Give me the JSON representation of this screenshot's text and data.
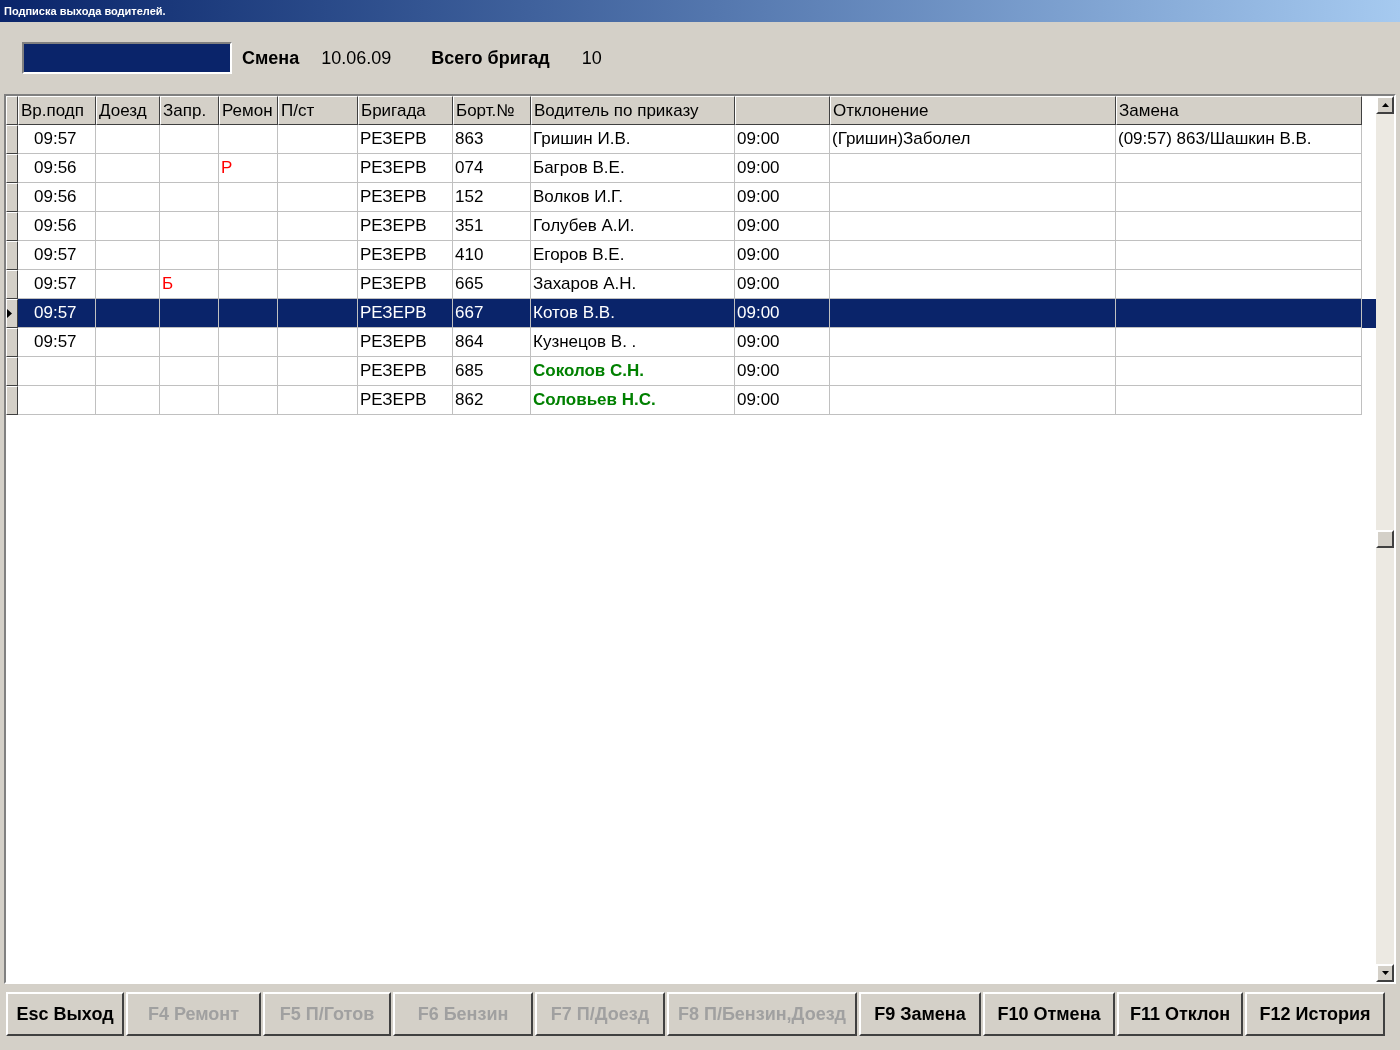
{
  "window": {
    "title": "Подписка выхода водителей."
  },
  "header": {
    "shift_label": "Смена",
    "shift_value": "10.06.09",
    "total_label": "Всего бригад",
    "total_value": "10"
  },
  "table": {
    "columns": [
      {
        "label": "Вр.подп"
      },
      {
        "label": "Доезд"
      },
      {
        "label": "Запр."
      },
      {
        "label": "Ремон"
      },
      {
        "label": "П/ст"
      },
      {
        "label": "Бригада"
      },
      {
        "label": "Борт.№"
      },
      {
        "label": "Водитель по приказу"
      },
      {},
      {
        "label": "Отклонение"
      },
      {
        "label": "Замена"
      }
    ],
    "rows": [
      {
        "selected": false,
        "driver_highlighted": false,
        "cells": [
          "09:57",
          "",
          "",
          "",
          "",
          "РЕЗЕРВ",
          "863",
          "Гришин И.В.",
          "09:00",
          "(Гришин)Заболел",
          "(09:57) 863/Шашкин В.В."
        ]
      },
      {
        "selected": false,
        "driver_highlighted": false,
        "cells": [
          "09:56",
          "",
          "",
          "Р",
          "",
          "РЕЗЕРВ",
          "074",
          "Багров В.Е.",
          "09:00",
          "",
          ""
        ]
      },
      {
        "selected": false,
        "driver_highlighted": false,
        "cells": [
          "09:56",
          "",
          "",
          "",
          "",
          "РЕЗЕРВ",
          "152",
          "Волков И.Г.",
          "09:00",
          "",
          ""
        ]
      },
      {
        "selected": false,
        "driver_highlighted": false,
        "cells": [
          "09:56",
          "",
          "",
          "",
          "",
          "РЕЗЕРВ",
          "351",
          "Голубев А.И.",
          "09:00",
          "",
          ""
        ]
      },
      {
        "selected": false,
        "driver_highlighted": false,
        "cells": [
          "09:57",
          "",
          "",
          "",
          "",
          "РЕЗЕРВ",
          "410",
          "Егоров В.Е.",
          "09:00",
          "",
          ""
        ]
      },
      {
        "selected": false,
        "driver_highlighted": false,
        "cells": [
          "09:57",
          "",
          "Б",
          "",
          "",
          "РЕЗЕРВ",
          "665",
          "Захаров А.Н.",
          "09:00",
          "",
          ""
        ]
      },
      {
        "selected": true,
        "driver_highlighted": false,
        "cells": [
          "09:57",
          "",
          "",
          "",
          "",
          "РЕЗЕРВ",
          "667",
          "Котов В.В.",
          "09:00",
          "",
          ""
        ]
      },
      {
        "selected": false,
        "driver_highlighted": false,
        "cells": [
          "09:57",
          "",
          "",
          "",
          "",
          "РЕЗЕРВ",
          "864",
          "Кузнецов В. .",
          "09:00",
          "",
          ""
        ]
      },
      {
        "selected": false,
        "driver_highlighted": true,
        "cells": [
          "",
          "",
          "",
          "",
          "",
          "РЕЗЕРВ",
          "685",
          "Соколов С.Н.",
          "09:00",
          "",
          ""
        ]
      },
      {
        "selected": false,
        "driver_highlighted": true,
        "cells": [
          "",
          "",
          "",
          "",
          "",
          "РЕЗЕРВ",
          "862",
          "Соловьев Н.С.",
          "09:00",
          "",
          ""
        ]
      }
    ]
  },
  "buttons": [
    {
      "label": "Esc Выход",
      "disabled": false
    },
    {
      "label": "F4 Ремонт",
      "disabled": true
    },
    {
      "label": "F5 П/Готов",
      "disabled": true
    },
    {
      "label": "F6 Бензин",
      "disabled": true
    },
    {
      "label": "F7 П/Доезд",
      "disabled": true
    },
    {
      "label": "F8 П/Бензин,Доезд",
      "disabled": true
    },
    {
      "label": "F9 Замена",
      "disabled": false
    },
    {
      "label": "F10 Отмена",
      "disabled": false
    },
    {
      "label": "F11 Отклон",
      "disabled": false
    },
    {
      "label": "F12 История",
      "disabled": false
    }
  ]
}
